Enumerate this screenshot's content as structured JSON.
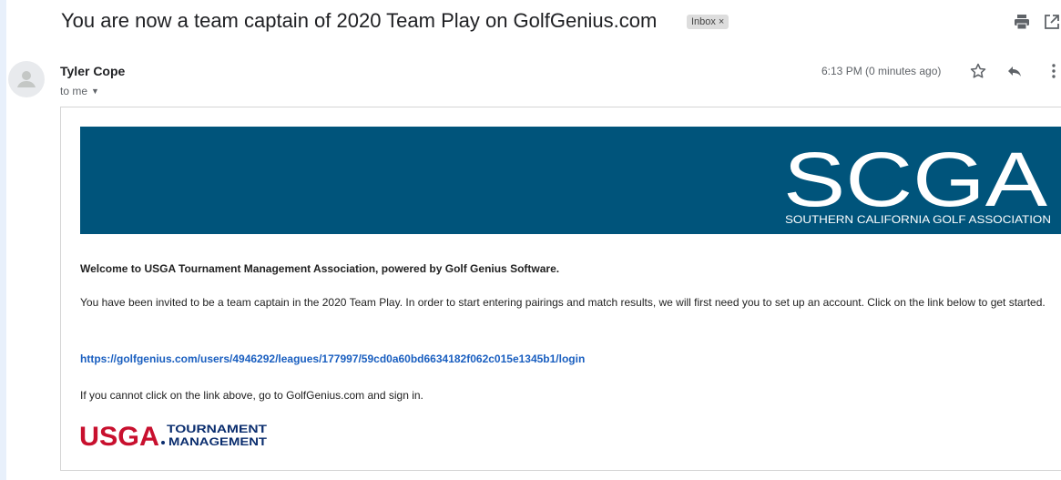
{
  "email": {
    "subject": "You are now a team captain of 2020 Team Play on GolfGenius.com",
    "label_badge": "Inbox",
    "label_badge_close": "×",
    "sender": {
      "name": "Tyler Cope",
      "recipient_text": "to me"
    },
    "timestamp": "6:13 PM (0 minutes ago)"
  },
  "icons": {
    "print": "print-icon",
    "open_new_window": "open-in-new-icon",
    "avatar": "person-avatar-icon",
    "dropdown": "chevron-down-icon",
    "star": "star-outline-icon",
    "reply": "reply-icon",
    "more": "more-vert-icon"
  },
  "message": {
    "banner": {
      "logo_text": "SCGA",
      "logo_subtitle": "SOUTHERN CALIFORNIA GOLF ASSOCIATION",
      "background_color": "#00547b"
    },
    "welcome": "Welcome to USGA Tournament Management Association, powered by Golf Genius Software.",
    "invite_text": "You have been invited to be a team captain in the 2020 Team Play. In order to start entering pairings and match results, we will first need you to set up an account. Click on the link below to get started.",
    "login_link": "https://golfgenius.com/users/4946292/leagues/177997/59cd0a60bd6634182f062c015e1345b1/login",
    "signin_text": "If you cannot click on the link above, go to GolfGenius.com and sign in.",
    "footer_logo": {
      "brand": "USGA",
      "line1": "TOURNAMENT",
      "line2": "MANAGEMENT",
      "brand_color": "#c8102e",
      "text_color": "#0a2d6e"
    }
  },
  "colors": {
    "link": "#1a5fc0",
    "page_background": "#e8f0fb"
  }
}
